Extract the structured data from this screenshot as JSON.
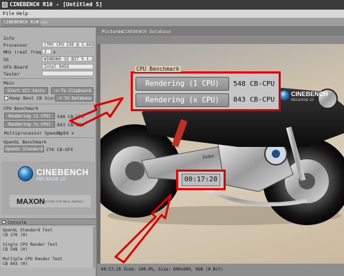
{
  "window": {
    "title": "CINEBENCH R10 - [Untitled 5]"
  },
  "menu": [
    "File",
    "Help"
  ],
  "tabs": {
    "main": "CINEBENCH R10",
    "view": "View"
  },
  "info": {
    "title": "Info",
    "rows": [
      {
        "label": "Processor",
        "value": "(TM) CPU 230 @ 1.60GHz"
      },
      {
        "label": "MHz (real freq.)",
        "value": "2",
        "unit": "x"
      },
      {
        "label": "OS",
        "value": "WINDOWS 32 BIT 5.1.260"
      },
      {
        "label": "GFX-Board",
        "value": "Intel 945G"
      },
      {
        "label": "Tester",
        "value": ""
      }
    ]
  },
  "main": {
    "title": "Main",
    "start_all": "Start all tests",
    "to_clipboard": "-> To Clipboard",
    "keep_best": "Keep Best CB Score",
    "to_database": "-> To Database"
  },
  "cpu_benchmark": {
    "title": "CPU Benchmark",
    "render_1": "Rendering (1 CPU)",
    "render_1_value": "548 CB-CPU",
    "render_x": "Rendering (x CPU)",
    "render_x_value": "843 CB-CPU",
    "speedup_label": "Multiprocessor Speedup:",
    "speedup_value": "1.54 x"
  },
  "opengl": {
    "title": "OpenGL Benchmark",
    "button": "OpenGL Standard",
    "value": "276 CB-GFX"
  },
  "logo": {
    "name": "CINEBENCH",
    "release": "RELEASE 10",
    "maxon": "MAXON",
    "tagline": "3D FOR THE REAL WORLD"
  },
  "console": {
    "title": "Console",
    "lines": [
      "OpenGL Standard Test",
      "CB 276 (0)",
      "",
      "Single CPU Render Test",
      "CB 548 (0)",
      "",
      "Multiple CPU Render Test",
      "CB 843 (0)"
    ]
  },
  "right_tabs": {
    "pictures": "Pictures",
    "database": "CINEBENCH Database"
  },
  "callout": {
    "header": "CPU Benchmark",
    "render_1": "Rendering (1 CPU)",
    "render_1_value": "548 CB-CPU",
    "render_x": "Rendering (x CPU)",
    "render_x_value": "843 CB-CPU",
    "timer": "00:17:28"
  },
  "decal": {
    "brand": "CINEBENCH",
    "release": "RELEASE 10",
    "side_text": "Zoltar"
  },
  "status": "00:17:28 Zoom: 100.0%, Size: 800x600, RGB (8 Bit)",
  "colors": {
    "callout_border": "#e10000",
    "arrow": "#e10000",
    "titlebar": "#3b3b3b",
    "panel": "#b3b3b3"
  }
}
